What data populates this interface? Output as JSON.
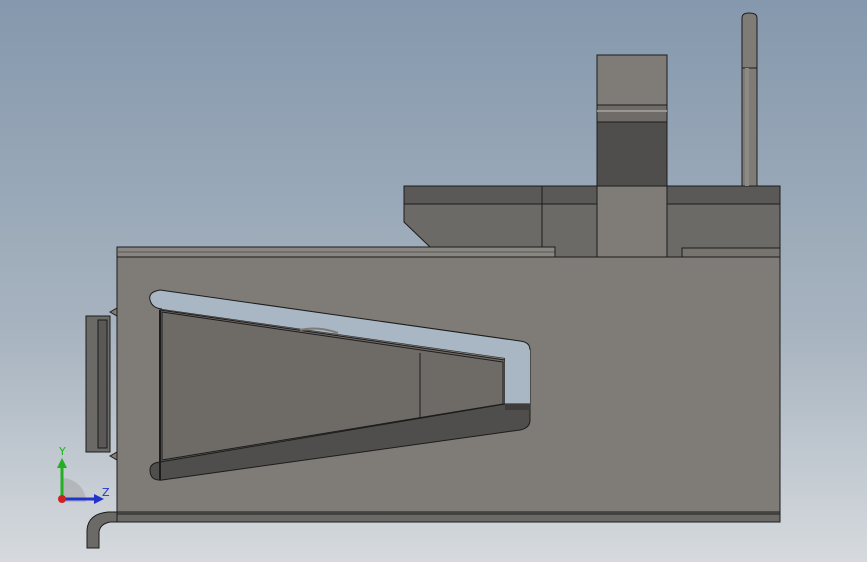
{
  "viewport": {
    "background_top": "#8598ad",
    "background_bottom": "#d6dade"
  },
  "model": {
    "body_color": "#7f7b76",
    "dark_color": "#4f4e4c",
    "mid_color": "#6c6a67",
    "edge_color": "#1c1c1c",
    "highlight_color": "#a9b7c4"
  },
  "triad": {
    "y_label": "Y",
    "z_label": "Z",
    "y_color": "#22b022",
    "z_color": "#2233cc",
    "x_color": "#cc2222"
  }
}
